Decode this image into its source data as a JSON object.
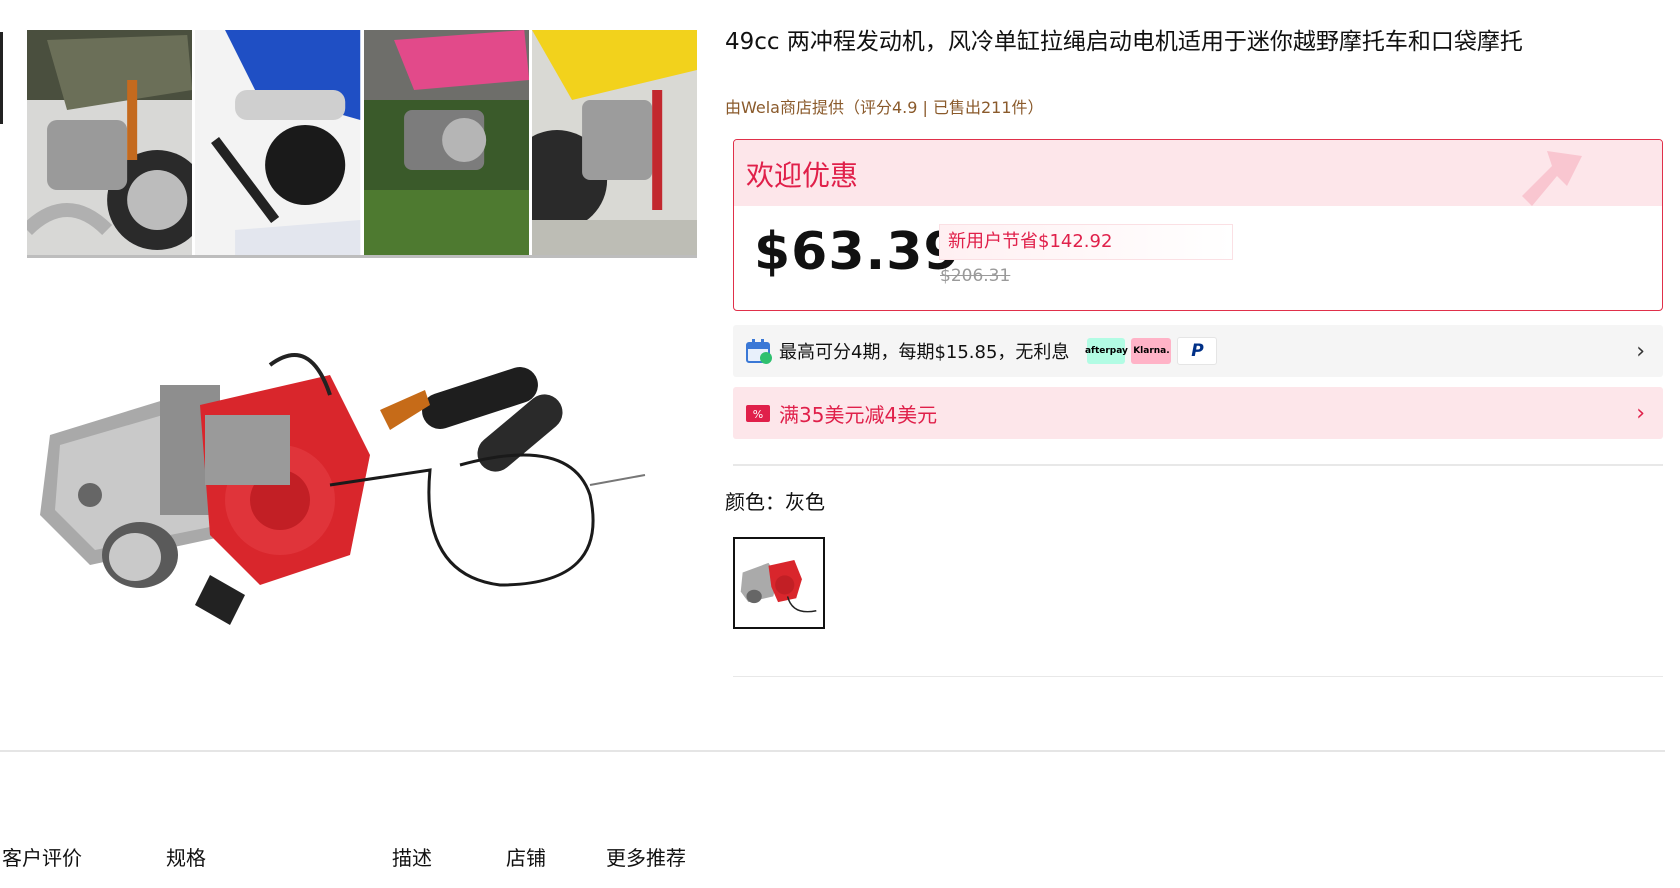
{
  "product": {
    "title": "49cc 两冲程发动机，风冷单缸拉绳启动电机适用于迷你越野摩托车和口袋摩托",
    "store_line": "由Wela商店提供（评分4.9 | 已售出211件）"
  },
  "promo": {
    "title": "欢迎优惠",
    "price": "$63.39",
    "save_text": "新用户节省$142.92",
    "original_price": "$206.31"
  },
  "installment": {
    "text": "最高可分4期，每期$15.85，无利息",
    "logos": [
      "afterpay",
      "Klarna.",
      "P"
    ]
  },
  "coupon": {
    "text": "满35美元减4美元"
  },
  "variant": {
    "label": "颜色：灰色"
  },
  "tabs": [
    "客户评价",
    "规格",
    "描述",
    "店铺",
    "更多推荐"
  ],
  "colors": {
    "accent": "#e0204a",
    "promo_bg": "#fde6ea",
    "engine_red": "#d9262c"
  }
}
